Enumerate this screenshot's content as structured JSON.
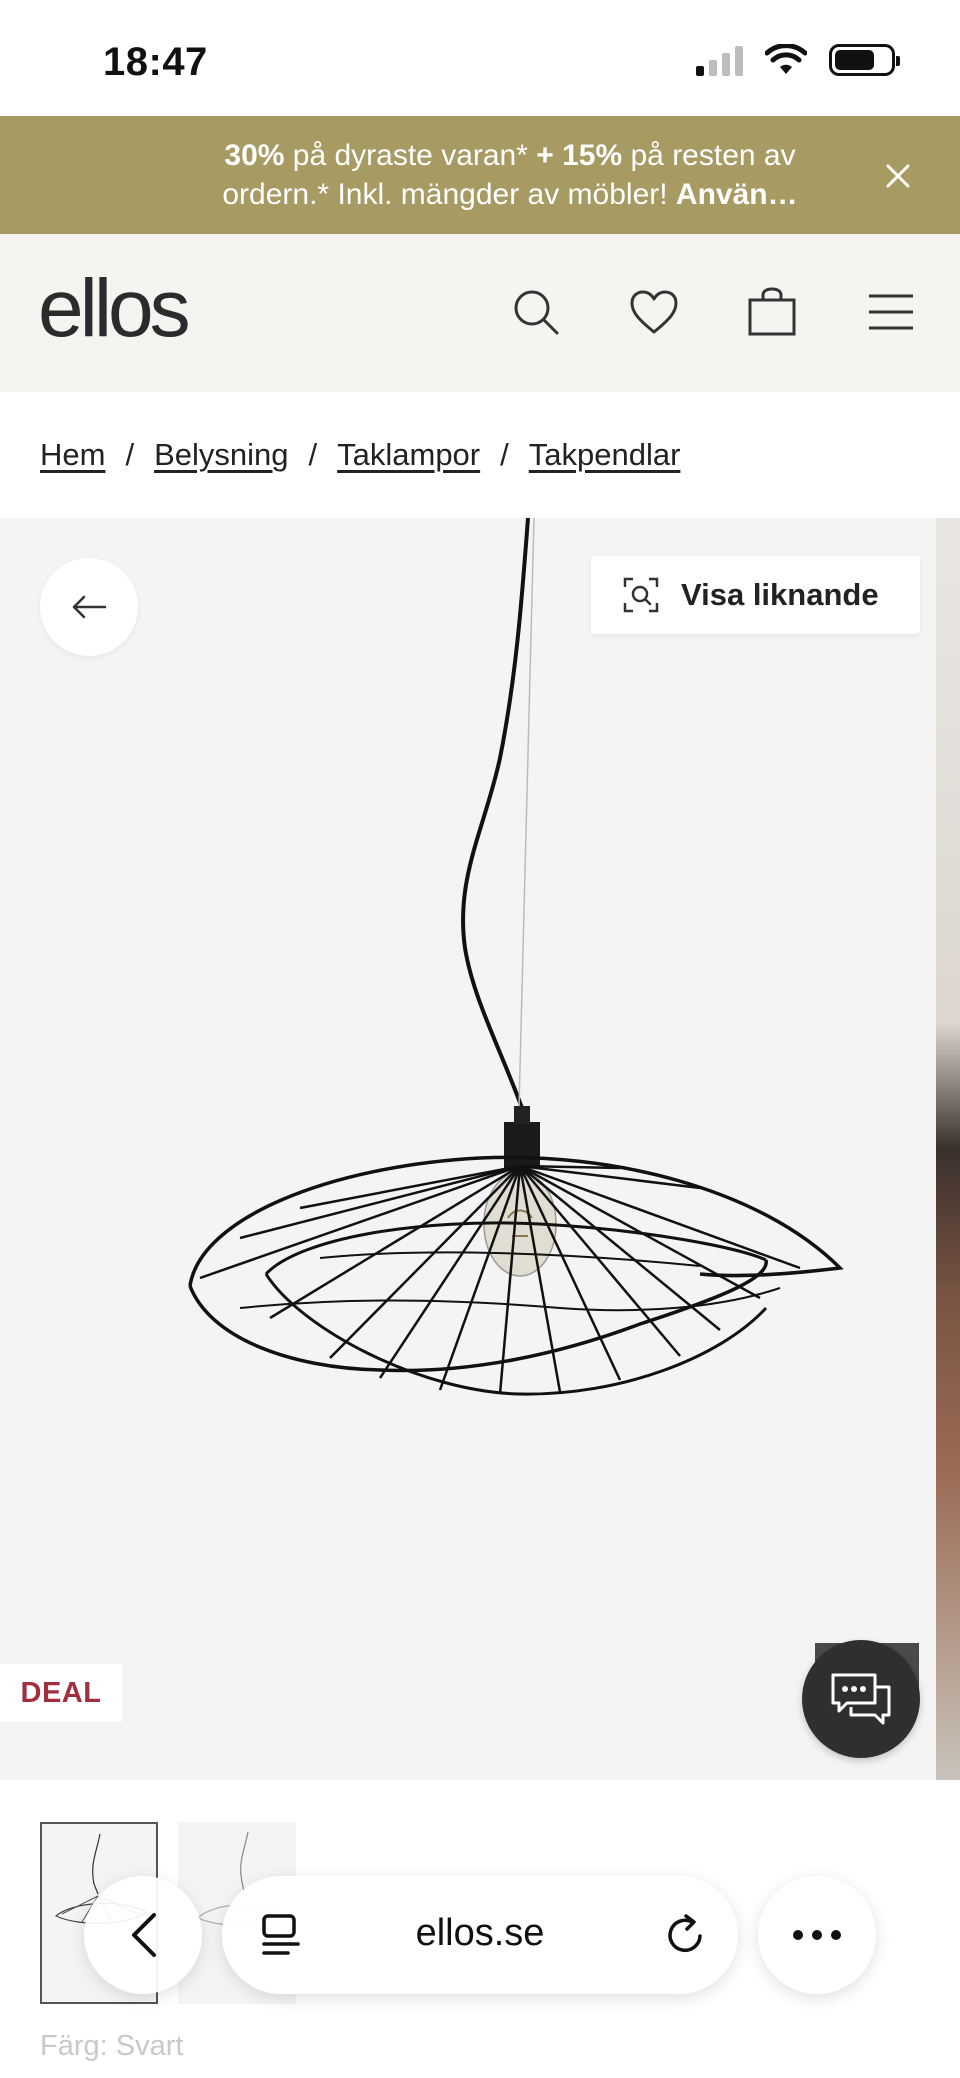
{
  "status_bar": {
    "time": "18:47"
  },
  "promo": {
    "part1_bold": "30%",
    "part2": " på dyraste varan* ",
    "part3_bold": "+ 15%",
    "part4": " på resten av ordern.* Inkl. mängder av möbler! ",
    "part5_bold": "Använ…"
  },
  "header": {
    "logo": "ellos"
  },
  "breadcrumb": {
    "items": [
      "Hem",
      "Belysning",
      "Taklampor",
      "Takpendlar"
    ],
    "separator": "/"
  },
  "gallery": {
    "similar_label": "Visa liknande",
    "badge": "DEAL"
  },
  "product": {
    "color_label": "Färg: Svart"
  },
  "browser": {
    "url": "ellos.se"
  },
  "colors": {
    "promo_bg": "#a89a63",
    "header_bg": "#f6f4f1",
    "deal_red": "#a03040",
    "chat_bg": "#2f2f2f"
  }
}
